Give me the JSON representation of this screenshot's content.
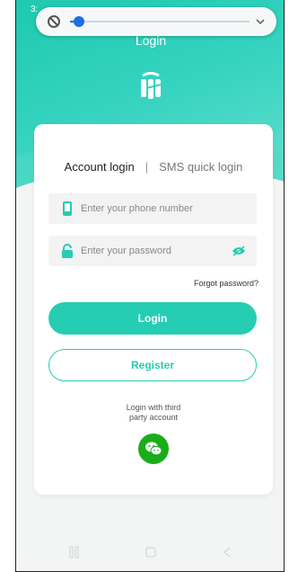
{
  "status": {
    "time": "3:",
    "right": ""
  },
  "media_control": {
    "volume_fraction": 0.05
  },
  "header": {
    "title": "Login"
  },
  "tabs": {
    "account": "Account login",
    "separator": "|",
    "sms": "SMS quick login"
  },
  "form": {
    "phone_placeholder": "Enter your phone number",
    "password_placeholder": "Enter your password",
    "forgot": "Forgot password?",
    "login_button": "Login",
    "register_button": "Register"
  },
  "third_party": {
    "line1": "Login with third",
    "line2": "party account"
  },
  "colors": {
    "accent": "#25cdb3",
    "wechat": "#1aad19",
    "slider": "#1d6fe6"
  },
  "icons": [
    "mute-icon",
    "chevron-down-icon",
    "app-logo-icon",
    "phone-icon",
    "lock-icon",
    "eye-icon",
    "wechat-icon",
    "recent-apps-icon",
    "home-icon",
    "back-icon"
  ]
}
